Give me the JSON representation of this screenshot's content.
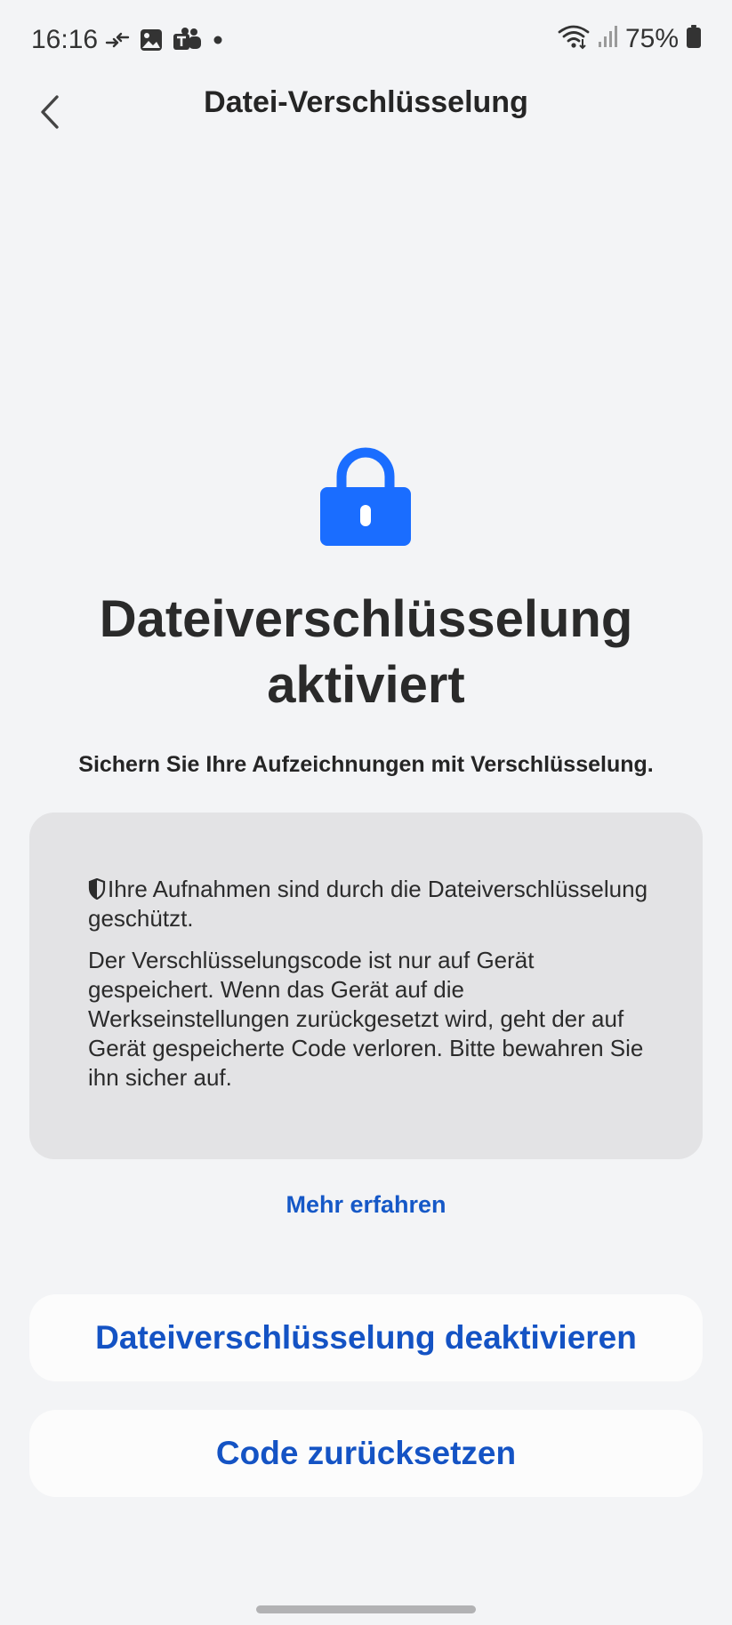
{
  "status_bar": {
    "time": "16:16",
    "battery": "75%",
    "icons_left": [
      "data-transfer-icon",
      "gallery-icon",
      "teams-icon",
      "notification-dot-icon"
    ],
    "icons_right": [
      "wifi-icon",
      "signal-icon",
      "battery-icon"
    ]
  },
  "app_bar": {
    "title": "Datei-Verschlüsselung"
  },
  "hero": {
    "icon": "lock-icon",
    "icon_color": "#1a6dff",
    "title": "Dateiverschlüsselung aktiviert",
    "subtitle": "Sichern Sie Ihre Aufzeichnungen mit Verschlüsselung."
  },
  "info_card": {
    "paragraph_1": "Ihre Aufnahmen sind durch die Dateiverschlüsselung geschützt.",
    "paragraph_2": "Der Verschlüsselungscode ist nur auf Gerät gespeichert. Wenn das Gerät auf die Werkseinstellungen zurückgesetzt wird, geht der auf Gerät gespeicherte Code verloren. Bitte bewahren Sie ihn sicher auf."
  },
  "links": {
    "learn_more": "Mehr erfahren"
  },
  "buttons": {
    "deactivate": "Dateiverschlüsselung deaktivieren",
    "reset_code": "Code zurücksetzen"
  },
  "colors": {
    "accent": "#1453c4",
    "background": "#f3f4f6",
    "card": "#e3e3e5"
  }
}
